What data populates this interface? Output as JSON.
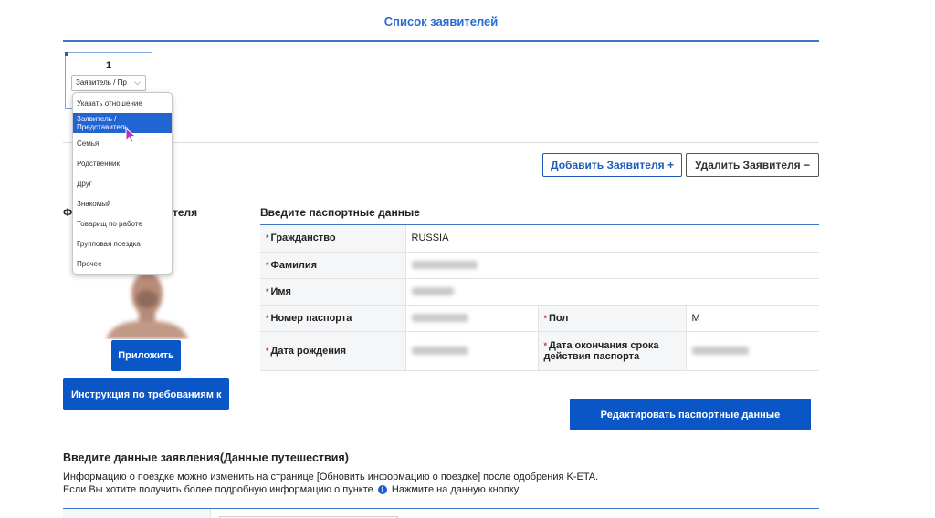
{
  "header": {
    "title": "Список заявителей"
  },
  "applicant_card": {
    "number": "1",
    "relation_value": "Заявитель / Пр"
  },
  "relation_dropdown": {
    "options": [
      {
        "label": "Указать отношение"
      },
      {
        "label": "Заявитель / Представитель",
        "selected": true
      },
      {
        "label": "Семья"
      },
      {
        "label": "Родственник"
      },
      {
        "label": "Друг"
      },
      {
        "label": "Знакомый"
      },
      {
        "label": "Товарищ по работе"
      },
      {
        "label": "Групповая поездка"
      },
      {
        "label": "Прочее"
      }
    ]
  },
  "buttons": {
    "add_applicant": "Добавить Заявителя +",
    "delete_applicant": "Удалить Заявителя −",
    "attach": "Приложить",
    "instructions": "Инструкция по требованиям к",
    "edit_passport": "Редактировать паспортные данные"
  },
  "photo_section": {
    "heading_left": "Ф",
    "heading_right": "теля"
  },
  "passport": {
    "heading": "Введите паспортные данные",
    "required_mark": "*",
    "citizenship_label": "Гражданство",
    "citizenship_value": "RUSSIA",
    "surname_label": "Фамилия",
    "name_label": "Имя",
    "passport_number_label": "Номер паспорта",
    "sex_label": "Пол",
    "sex_value": "M",
    "birth_date_label": "Дата рождения",
    "expiry_label": "Дата окончания срока действия паспорта"
  },
  "trip": {
    "heading": "Введите данные заявления(Данные путешествия)",
    "line1": "Информацию о поездке можно изменить на странице [Обновить информацию о поездке] после одобрения K-ETA.",
    "line2_before": "Если Вы хотите получить более подробную информацию о пункте",
    "info_glyph": "i",
    "line2_after": "Нажмите на данную кнопку"
  },
  "colors": {
    "primary": "#0b56c6",
    "accent_text": "#2a6ad6",
    "required": "#d0302f",
    "selected_option": "#2264d1"
  },
  "icons": {
    "dropdown_chevron": "chevron-down-icon",
    "info": "info-icon",
    "cursor": "mouse-pointer-icon"
  }
}
